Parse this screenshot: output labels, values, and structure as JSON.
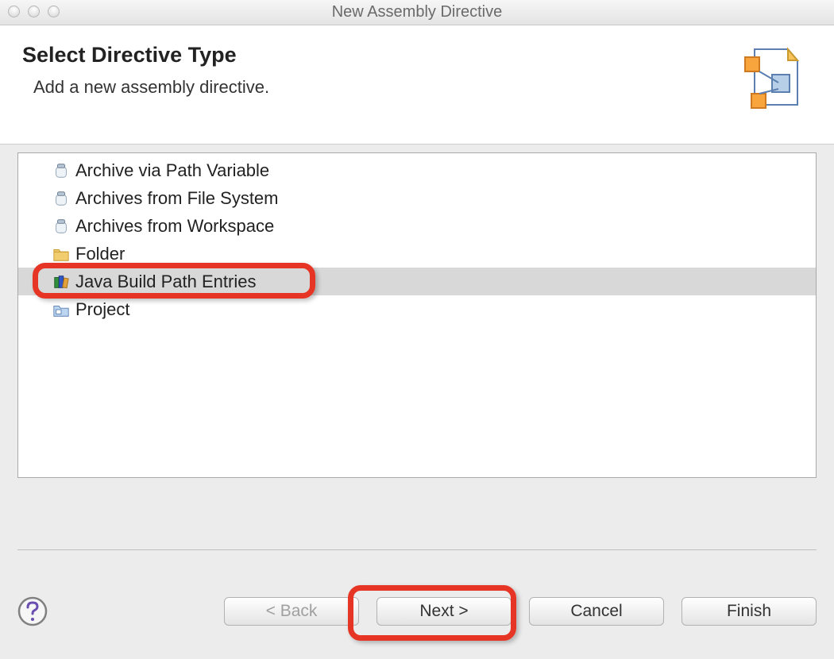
{
  "window_title": "New Assembly Directive",
  "header": {
    "title": "Select Directive Type",
    "subtitle": "Add a new assembly directive."
  },
  "list": {
    "items": [
      {
        "label": "Archive via Path Variable",
        "icon": "jar-icon",
        "selected": false
      },
      {
        "label": "Archives from File System",
        "icon": "jar-icon",
        "selected": false
      },
      {
        "label": "Archives from Workspace",
        "icon": "jar-icon",
        "selected": false
      },
      {
        "label": "Folder",
        "icon": "folder-icon",
        "selected": false
      },
      {
        "label": "Java Build Path Entries",
        "icon": "books-icon",
        "selected": true
      },
      {
        "label": "Project",
        "icon": "project-icon",
        "selected": false
      }
    ]
  },
  "buttons": {
    "back": "< Back",
    "next": "Next >",
    "cancel": "Cancel",
    "finish": "Finish",
    "back_enabled": false,
    "next_enabled": true,
    "cancel_enabled": true,
    "finish_enabled": true
  },
  "highlights": [
    "list-item-java-build-path-entries",
    "next-button"
  ]
}
